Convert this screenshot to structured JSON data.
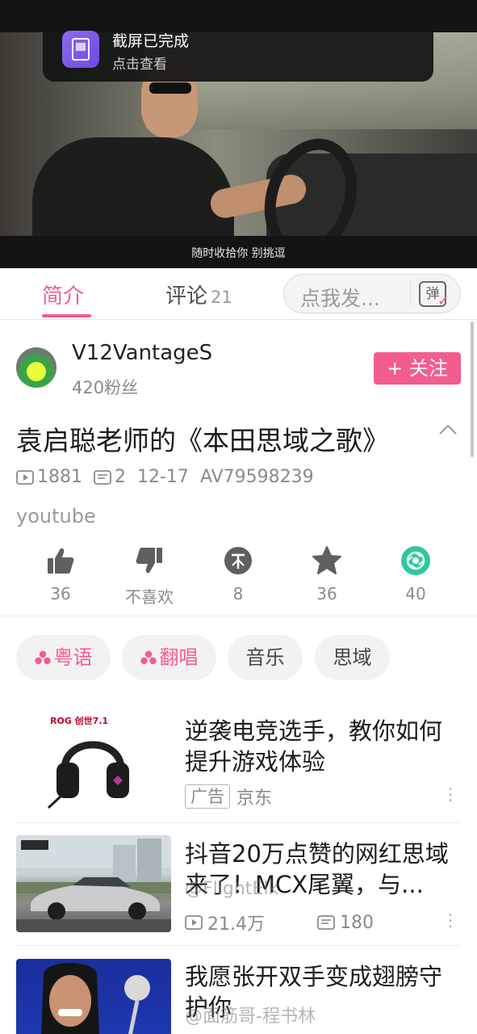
{
  "toast": {
    "title": "截屏已完成",
    "subtitle": "点击查看"
  },
  "video": {
    "subtitle": "随时收拾你 别挑逗"
  },
  "tabs": {
    "intro_label": "简介",
    "comments_label": "评论",
    "comments_count": "21",
    "danmaku_placeholder": "点我发...",
    "danmaku_icon_text": "弹"
  },
  "uploader": {
    "name": "V12VantageS",
    "fans": "420粉丝",
    "follow_label": "+ 关注"
  },
  "video_info": {
    "title": "袁启聪老师的《本田思域之歌》",
    "views": "1881",
    "danmaku_count": "2",
    "date": "12-17",
    "av_id": "AV79598239",
    "source": "youtube"
  },
  "actions": [
    {
      "icon": "thumbs-up-icon",
      "label": "36"
    },
    {
      "icon": "thumbs-down-icon",
      "label": "不喜欢"
    },
    {
      "icon": "coin-icon",
      "label": "8"
    },
    {
      "icon": "star-icon",
      "label": "36"
    },
    {
      "icon": "share-icon",
      "label": "40"
    }
  ],
  "tags": [
    {
      "label": "粤语",
      "highlighted": true
    },
    {
      "label": "翻唱",
      "highlighted": true
    },
    {
      "label": "音乐",
      "highlighted": false
    },
    {
      "label": "思域",
      "highlighted": false
    }
  ],
  "recommendations": [
    {
      "title": "逆袭电竞选手，教你如何提升游戏体验",
      "ad_badge": "广告",
      "advertiser": "京东",
      "thumb_text": "ROG 创世7.1"
    },
    {
      "title": "抖音20万点赞的网红思域来了！MCX尾翼，与...",
      "views": "21.4万",
      "danmaku": "180",
      "watermark": "@FlightElk"
    },
    {
      "title": "我愿张开双手变成翅膀守护你",
      "watermark": "@面筋哥-程书林"
    }
  ],
  "colors": {
    "accent": "#f25d8e",
    "share_green": "#2fc7a1",
    "icon_gray": "#5f5f5f"
  }
}
